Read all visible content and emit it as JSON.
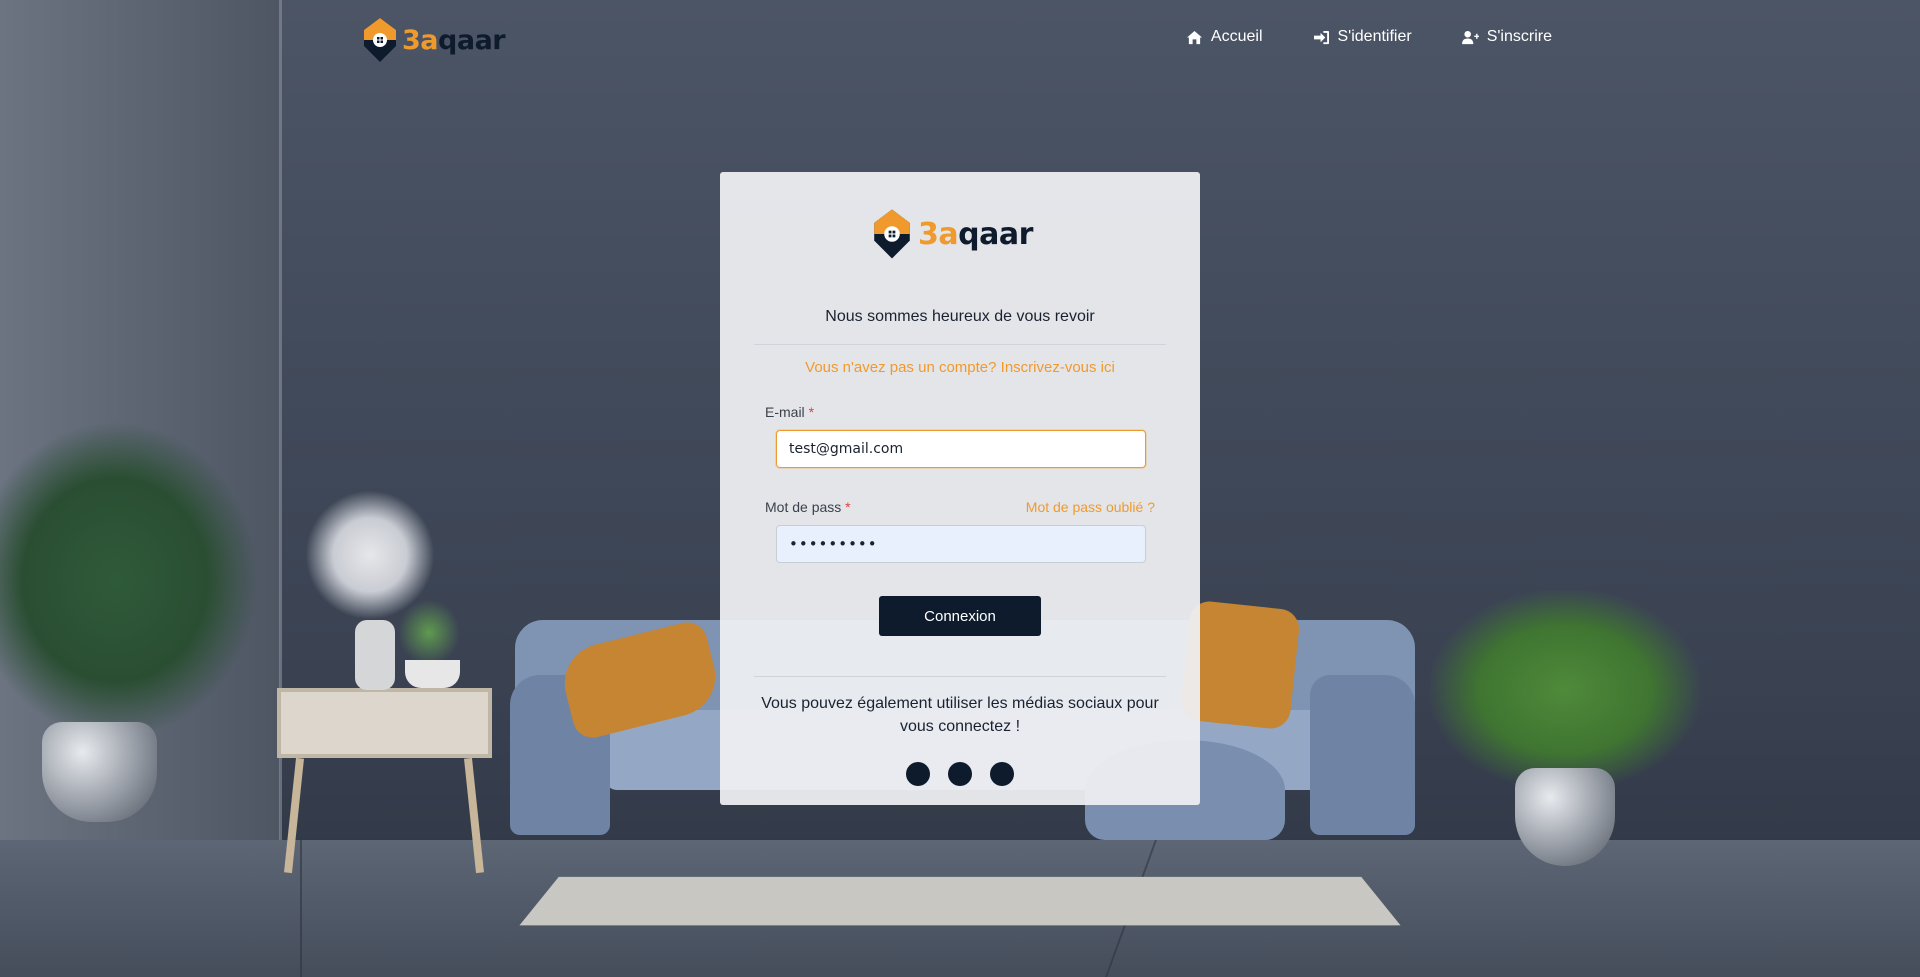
{
  "brand": {
    "part_a": "3a",
    "part_b": "qaar"
  },
  "nav": {
    "items": [
      {
        "label": "Accueil",
        "icon": "home-icon"
      },
      {
        "label": "S'identifier",
        "icon": "sign-in-icon"
      },
      {
        "label": "S'inscrire",
        "icon": "user-plus-icon"
      }
    ]
  },
  "card": {
    "welcome": "Nous sommes heureux de vous revoir",
    "signup_link": "Vous n'avez pas un compte? Inscrivez-vous ici",
    "email": {
      "label": "E-mail",
      "required_mark": "*",
      "value": "test@gmail.com"
    },
    "password": {
      "label": "Mot de pass",
      "required_mark": "*",
      "value": "•••••••••"
    },
    "forgot_link": "Mot de pass oublié ?",
    "submit_label": "Connexion",
    "social_text": "Vous pouvez également utiliser les médias sociaux pour vous connectez !",
    "social_buttons": [
      "social-button-1",
      "social-button-2",
      "social-button-3"
    ]
  },
  "colors": {
    "accent": "#f09a2e",
    "dark": "#0e1b2c",
    "required": "#e0413a"
  }
}
